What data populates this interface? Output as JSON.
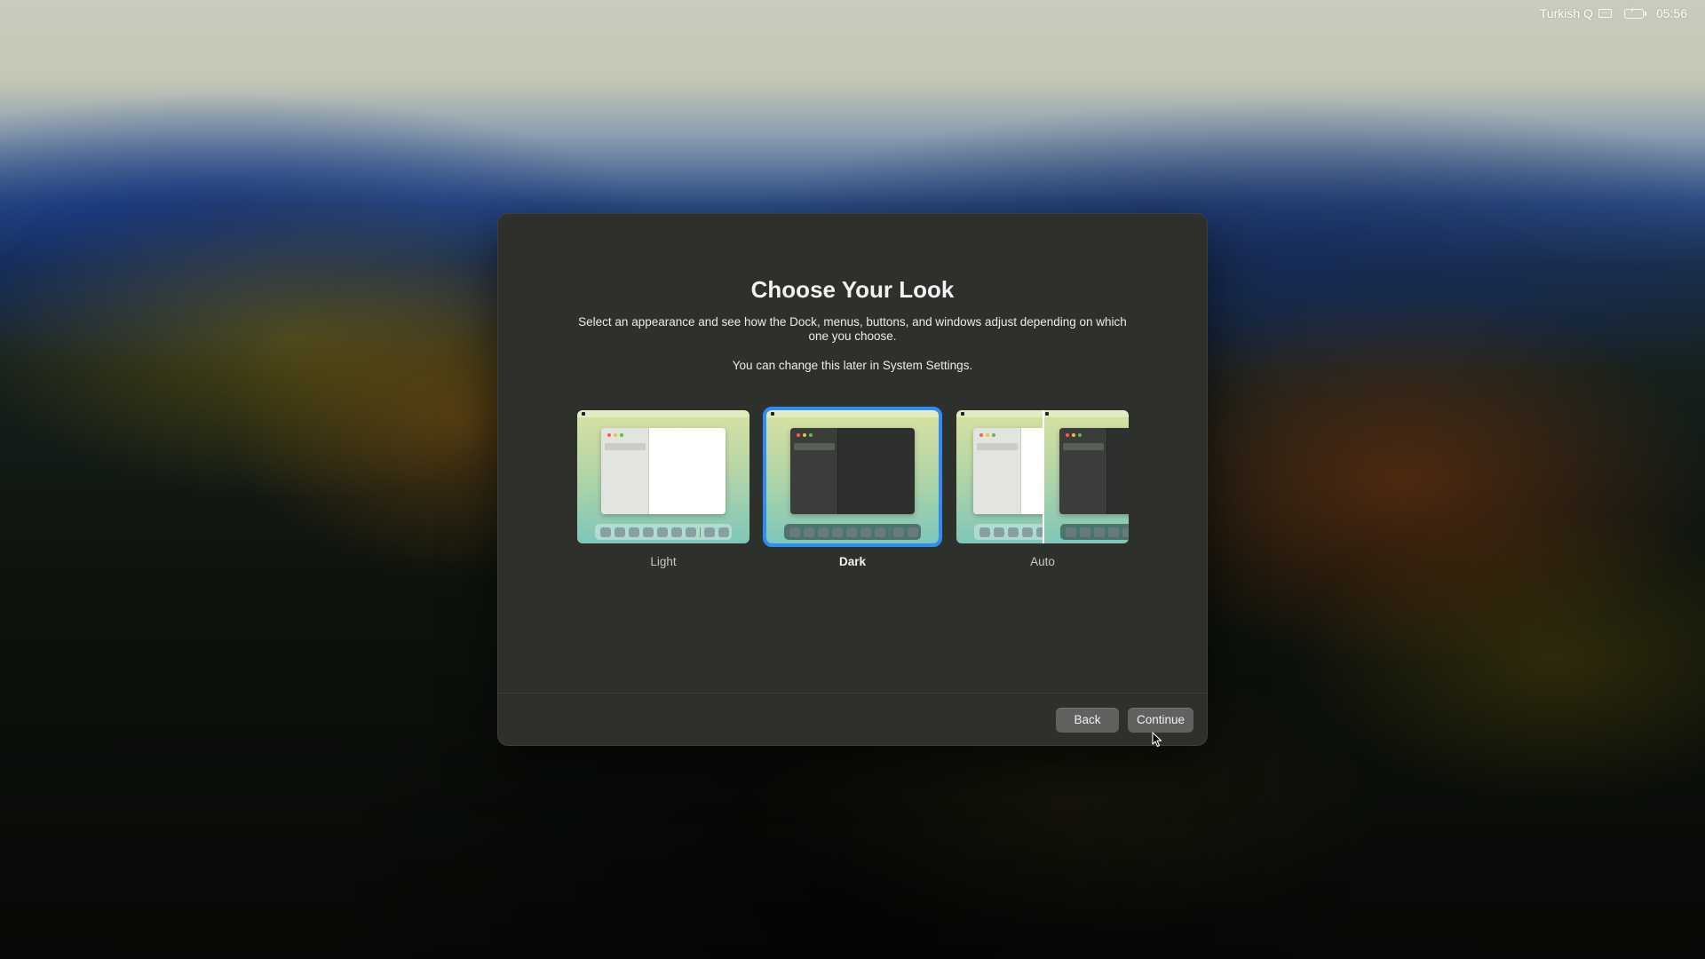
{
  "menubar": {
    "input_source": "Turkish Q",
    "clock": "05:56",
    "icons": [
      "keyboard-icon",
      "battery-charging-icon"
    ]
  },
  "dialog": {
    "title": "Choose Your Look",
    "description": "Select an appearance and see how the Dock, menus, buttons, and windows adjust depending on which one you choose.",
    "note": "You can change this later in System Settings.",
    "options": [
      {
        "label": "Light",
        "selected": false
      },
      {
        "label": "Dark",
        "selected": true
      },
      {
        "label": "Auto",
        "selected": false
      }
    ],
    "buttons": {
      "back": "Back",
      "continue": "Continue"
    },
    "accent_color": "#2f8cf5"
  }
}
